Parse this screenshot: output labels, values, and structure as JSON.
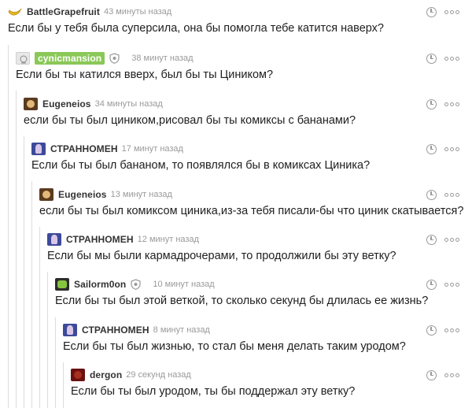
{
  "comments": [
    {
      "author": "BattleGrapefruit",
      "time": "43 минуты назад",
      "text": "Если бы у тебя была суперсила, она бы помогла тебе катится наверх?",
      "avatar": "banana-avatar",
      "op": false,
      "shield": false
    },
    {
      "author": "cynicmansion",
      "time": "38 минут назад",
      "text": "Если бы ты катился вверх, был бы ты Циником?",
      "avatar": "cynic-avatar",
      "op": true,
      "shield": true
    },
    {
      "author": "Eugeneios",
      "time": "34 минуты назад",
      "text": "если бы ты был циником,рисовал бы ты комиксы с бананами?",
      "avatar": "eugeneios-avatar",
      "op": false,
      "shield": false
    },
    {
      "author": "СТРАННОМЕН",
      "time": "17 минут назад",
      "text": "Если бы ты был бананом, то появлялся бы в комиксах Циника?",
      "avatar": "strannomen-avatar",
      "op": false,
      "shield": false
    },
    {
      "author": "Eugeneios",
      "time": "13 минут назад",
      "text": "если бы ты был комиксом циника,из-за тебя писали-бы что циник скатывается?",
      "avatar": "eugeneios-avatar",
      "op": false,
      "shield": false
    },
    {
      "author": "СТРАННОМЕН",
      "time": "12 минут назад",
      "text": "Если бы мы были кармадрочерами, то продолжили бы эту ветку?",
      "avatar": "strannomen-avatar",
      "op": false,
      "shield": false
    },
    {
      "author": "Sailorm0on",
      "time": "10 минут назад",
      "text": "Если бы ты был этой веткой, то сколько секунд бы длилась ее жизнь?",
      "avatar": "sailormoon-avatar",
      "op": false,
      "shield": true
    },
    {
      "author": "СТРАННОМЕН",
      "time": "8 минут назад",
      "text": "Если бы ты был жизнью, то стал бы меня делать таким уродом?",
      "avatar": "strannomen-avatar",
      "op": false,
      "shield": false
    },
    {
      "author": "dergon",
      "time": "29 секунд назад",
      "text": "Если бы ты был уродом, ты бы поддержал эту ветку?",
      "avatar": "dergon-avatar",
      "op": false,
      "shield": false
    }
  ],
  "icons": {
    "timestamp": "clock-icon",
    "menu": "more-dots-icon",
    "moderator": "shield-icon"
  },
  "colors": {
    "op_badge": "#8ac858",
    "muted": "#9a9a9a",
    "thread_line": "#dcdcdc"
  }
}
